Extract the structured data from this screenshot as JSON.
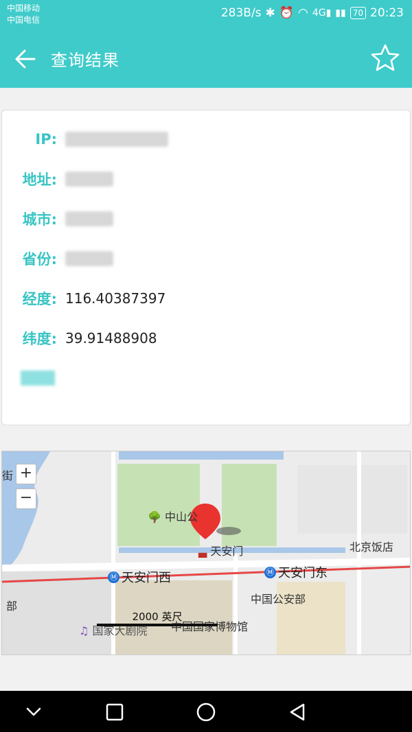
{
  "status_bar": {
    "carrier1": "中国移动",
    "carrier2": "中国电信",
    "speed": "283B/s",
    "signal_text": "4G",
    "battery": "70",
    "time": "20:23"
  },
  "app_bar": {
    "title": "查询结果"
  },
  "info": {
    "ip_label": "IP:",
    "address_label": "地址:",
    "city_label": "城市:",
    "province_label": "省份:",
    "longitude_label": "经度:",
    "longitude_value": "116.40387397",
    "latitude_label": "纬度:",
    "latitude_value": "39.91488908"
  },
  "map": {
    "zoom_in": "+",
    "zoom_out": "−",
    "labels": {
      "street": "街",
      "zhongshan": "中山公",
      "tiananmen": "天安门",
      "beijing_hotel": "北京饭店",
      "tiananmen_west": "天安门西",
      "tiananmen_east": "天安门东",
      "ministry": "中国公安部",
      "museum": "中国国家博物馆",
      "theater": "国家大剧院",
      "bu": "部"
    },
    "scale": "2000 英尺",
    "colors": {
      "water": "#a9c7e8",
      "park": "#c6e2b4",
      "rail": "#e64646",
      "pin": "#e8332f"
    }
  }
}
